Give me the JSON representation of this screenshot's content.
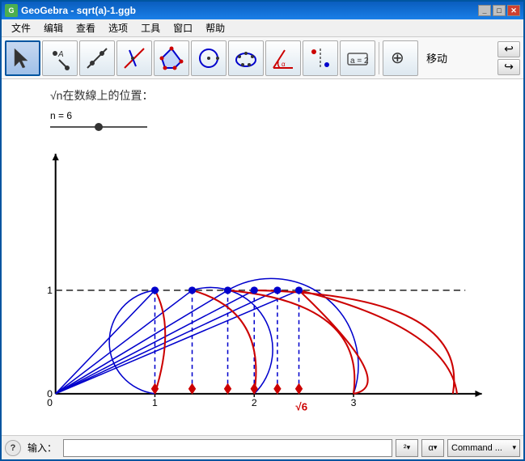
{
  "window": {
    "title": "GeoGebra - sqrt(a)-1.ggb",
    "icon_label": "G"
  },
  "menu": {
    "items": [
      "文件",
      "编辑",
      "查看",
      "选项",
      "工具",
      "窗口",
      "帮助"
    ]
  },
  "toolbar": {
    "tools": [
      {
        "name": "select",
        "label": "选择"
      },
      {
        "name": "point",
        "label": "点"
      },
      {
        "name": "line",
        "label": "直线"
      },
      {
        "name": "perpendicular",
        "label": "垂线"
      },
      {
        "name": "polygon",
        "label": "多边形"
      },
      {
        "name": "circle",
        "label": "圆"
      },
      {
        "name": "ellipse",
        "label": "椭圆"
      },
      {
        "name": "angle",
        "label": "角"
      },
      {
        "name": "reflect",
        "label": "反射"
      },
      {
        "name": "move",
        "label": "移动视图"
      }
    ],
    "move_label": "移动",
    "undo_label": "↩",
    "redo_label": "↪"
  },
  "canvas": {
    "annotation": "√n在数線上的位置：",
    "n_label": "n = 6",
    "sqrt6_label": "√6",
    "axis_0": "0",
    "axis_1": "1",
    "axis_2": "2",
    "axis_3": "3"
  },
  "statusbar": {
    "help_label": "?",
    "input_label": "输入：",
    "input_placeholder": "",
    "power_label": "²",
    "alpha_label": "α",
    "command_label": "Command ...",
    "command_display": "Command _"
  }
}
